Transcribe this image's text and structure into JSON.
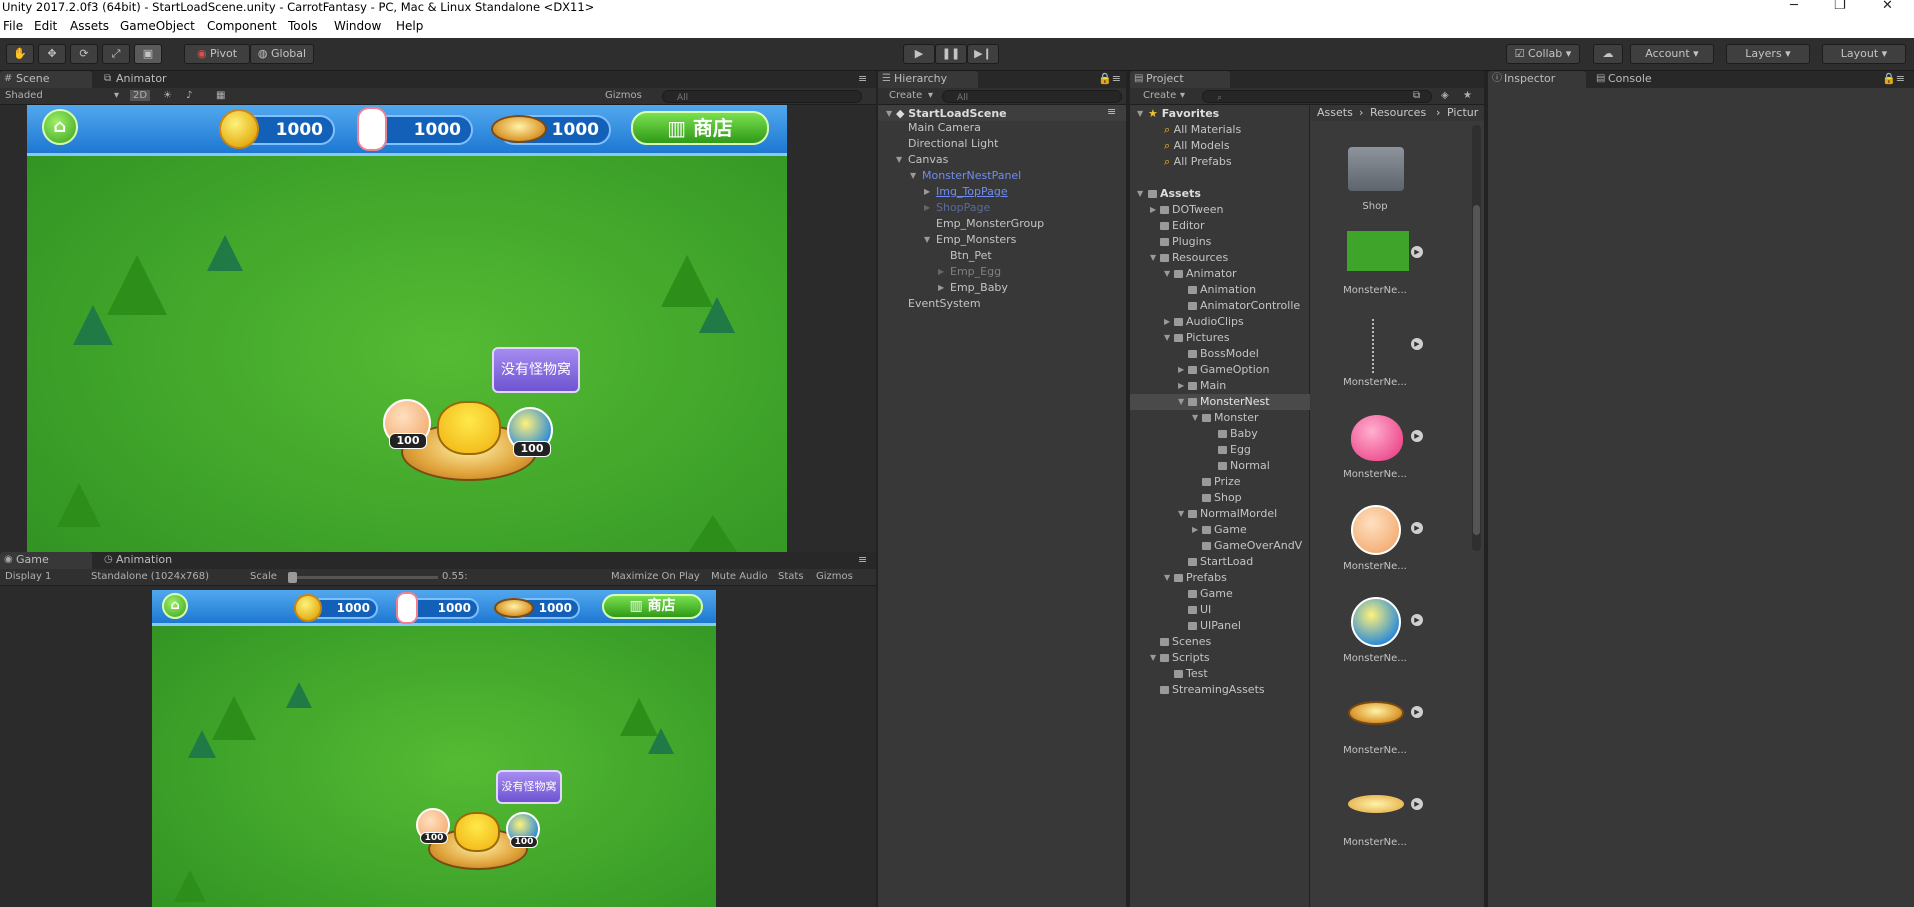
{
  "window": {
    "title": "Unity 2017.2.0f3 (64bit) - StartLoadScene.unity - CarrotFantasy - PC, Mac & Linux Standalone <DX11>",
    "minimize": "─",
    "maximize": "❐",
    "close": "✕"
  },
  "menu": [
    "File",
    "Edit",
    "Assets",
    "GameObject",
    "Component",
    "Tools",
    "Window",
    "Help"
  ],
  "toolbar": {
    "pivot": "Pivot",
    "global": "Global",
    "collab": "Collab",
    "account": "Account",
    "layers": "Layers",
    "layout": "Layout"
  },
  "scene_panel": {
    "tabs": [
      "Scene",
      "Animator"
    ],
    "shading": "Shaded",
    "mode_2d": "2D",
    "gizmos": "Gizmos",
    "search": "All"
  },
  "game_ui": {
    "coins": "1000",
    "milk": "1000",
    "nest": "1000",
    "shop": "商店",
    "bubble": "没有怪物窝",
    "badge_left": "100",
    "badge_right": "100"
  },
  "game_panel": {
    "tabs": [
      "Game",
      "Animation"
    ],
    "display": "Display 1",
    "resolution": "Standalone (1024x768)",
    "scale_label": "Scale",
    "scale_value": "0.55:",
    "maximize": "Maximize On Play",
    "mute": "Mute Audio",
    "stats": "Stats",
    "gizmos": "Gizmos"
  },
  "hierarchy": {
    "tab": "Hierarchy",
    "create": "Create",
    "search": "All",
    "scene": "StartLoadScene",
    "items": [
      "Main Camera",
      "Directional Light",
      "Canvas",
      "MonsterNestPanel",
      "Img_TopPage",
      "ShopPage",
      "Emp_MonsterGroup",
      "Emp_Monsters",
      "Btn_Pet",
      "Emp_Egg",
      "Emp_Baby",
      "EventSystem"
    ]
  },
  "project": {
    "tab": "Project",
    "create": "Create",
    "favorites": "Favorites",
    "fav_items": [
      "All Materials",
      "All Models",
      "All Prefabs"
    ],
    "assets": "Assets",
    "tree": [
      "DOTween",
      "Editor",
      "Plugins",
      "Resources",
      "Animator",
      "Animation",
      "AnimatorControlle",
      "AudioClips",
      "Pictures",
      "BossModel",
      "GameOption",
      "Main",
      "MonsterNest",
      "Monster",
      "Baby",
      "Egg",
      "Normal",
      "Prize",
      "Shop",
      "NormalMordel",
      "Game",
      "GameOverAndV",
      "StartLoad",
      "Prefabs",
      "Game",
      "UI",
      "UIPanel",
      "Scenes",
      "Scripts",
      "Test",
      "StreamingAssets"
    ],
    "breadcrumb": [
      "Assets",
      "Resources",
      "Pictur"
    ],
    "grid": [
      "Shop",
      "MonsterNe...",
      "MonsterNe...",
      "MonsterNe...",
      "MonsterNe...",
      "MonsterNe...",
      "MonsterNe...",
      "MonsterNe..."
    ]
  },
  "inspector": {
    "tab": "Inspector",
    "console": "Console"
  }
}
